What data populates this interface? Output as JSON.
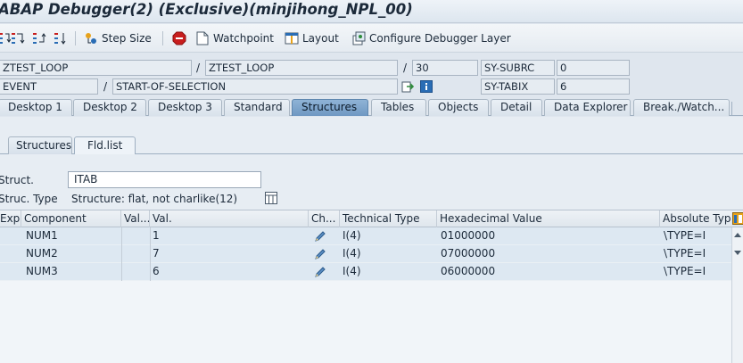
{
  "window": {
    "title": "ABAP Debugger(2)  (Exclusive)(minjihong_NPL_00)"
  },
  "toolbar": {
    "step_size": "Step Size",
    "watchpoint": "Watchpoint",
    "layout": "Layout",
    "configure_layer": "Configure Debugger Layer"
  },
  "context": {
    "program": "ZTEST_LOOP",
    "include": "ZTEST_LOOP",
    "line": "30",
    "event_type": "EVENT",
    "event_name": "START-OF-SELECTION",
    "sy_subrc_label": "SY-SUBRC",
    "sy_subrc_value": "0",
    "sy_tabix_label": "SY-TABIX",
    "sy_tabix_value": "6"
  },
  "tabs": [
    "Desktop 1",
    "Desktop 2",
    "Desktop 3",
    "Standard",
    "Structures",
    "Tables",
    "Objects",
    "Detail",
    "Data Explorer",
    "Break./Watch..."
  ],
  "active_tab": "Structures",
  "subtabs": [
    "Structures",
    "Fld.list"
  ],
  "active_subtab": "Fld.list",
  "struct": {
    "label": "Struct.",
    "value": "ITAB",
    "type_label": "Struc. Type",
    "type_value": "Structure: flat, not charlike(12)"
  },
  "grid": {
    "columns": [
      "Exp.",
      "Component",
      "Val...",
      "Val.",
      "Ch...",
      "Technical Type",
      "Hexadecimal Value",
      "Absolute Type"
    ],
    "rows": [
      {
        "component": "NUM1",
        "value": "1",
        "tech_type": "I(4)",
        "hex": "01000000",
        "abs_type": "\\TYPE=I"
      },
      {
        "component": "NUM2",
        "value": "7",
        "tech_type": "I(4)",
        "hex": "07000000",
        "abs_type": "\\TYPE=I"
      },
      {
        "component": "NUM3",
        "value": "6",
        "tech_type": "I(4)",
        "hex": "06000000",
        "abs_type": "\\TYPE=I"
      }
    ]
  },
  "colors": {
    "active_tab": "#7aa2c9",
    "row_bg": "#dde8f2",
    "stop_icon": "#c81e1e"
  },
  "icons": [
    "step-into-icon",
    "step-over-icon",
    "return-icon",
    "continue-icon",
    "step-size-icon",
    "stop-icon",
    "watchpoint-icon",
    "layout-icon",
    "configure-layer-icon",
    "edit-pencil-icon",
    "info-icon",
    "navigate-icon",
    "table-settings-icon"
  ]
}
